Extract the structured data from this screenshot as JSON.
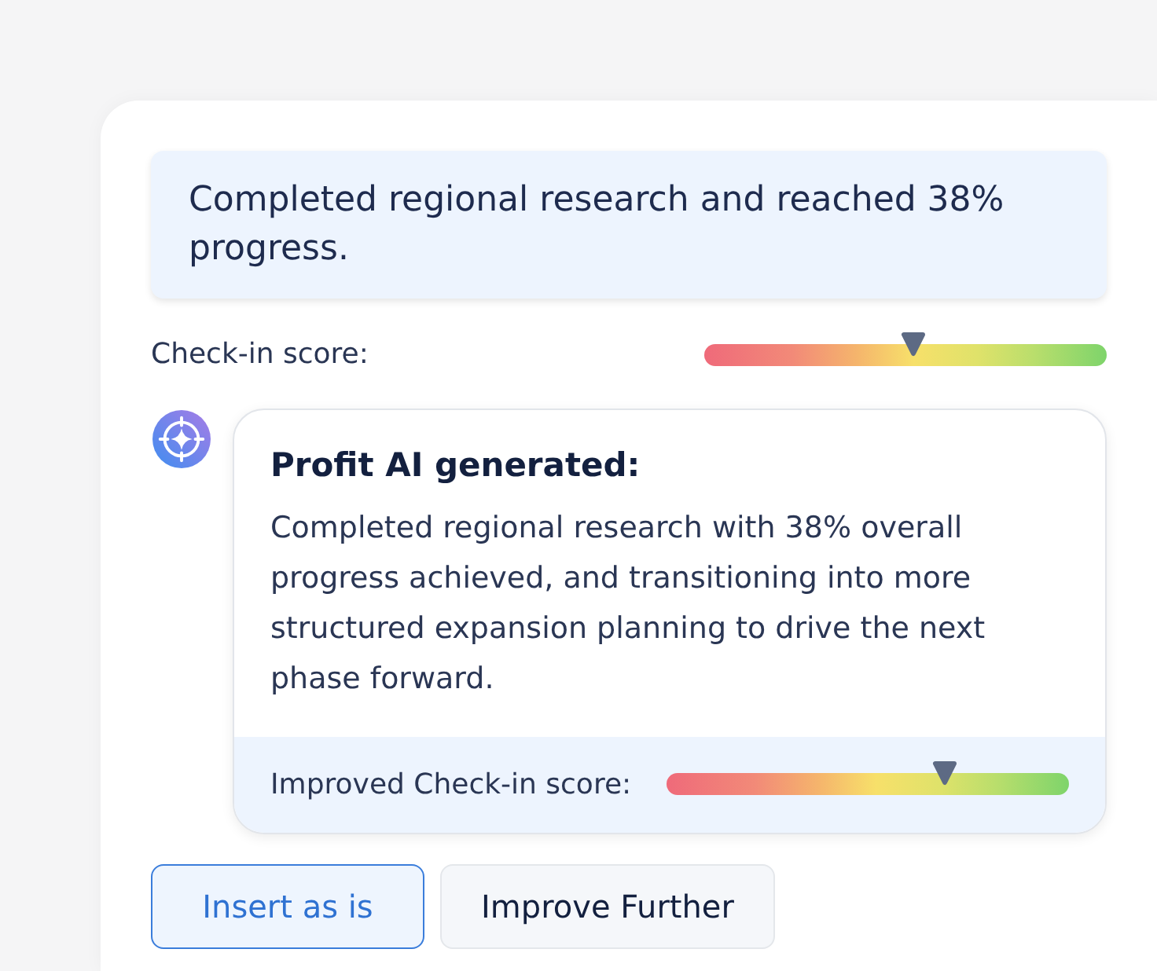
{
  "summary": {
    "text": "Completed regional research and reached 38% progress."
  },
  "check_in_score": {
    "label": "Check-in score:",
    "level": 0.52
  },
  "ai_suggestion": {
    "title": "Profit AI generated:",
    "text": "Completed regional research with 38% overall progress achieved, and transitioning into more structured expansion planning to drive the next phase forward.",
    "improved_score": {
      "label": "Improved Check-in score:",
      "level": 0.69
    }
  },
  "buttons": [
    {
      "label": "Insert as is",
      "kind": "primary"
    },
    {
      "label": "Improve Further",
      "kind": "secondary"
    }
  ]
}
